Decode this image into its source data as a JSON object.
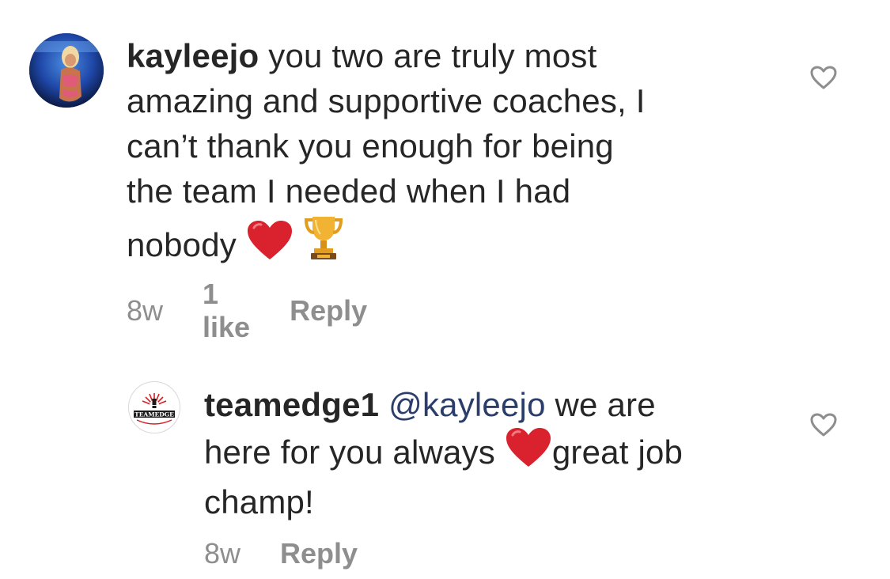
{
  "comments": [
    {
      "username": "kayleejo",
      "text_lines": [
        "you two are truly most",
        "amazing and supportive coaches, I",
        "can’t thank you enough for being",
        "the team I needed when I had",
        "nobody"
      ],
      "emojis": [
        "red-heart-emoji",
        "trophy-emoji"
      ],
      "time": "8w",
      "likes": "1 like",
      "reply_label": "Reply"
    },
    {
      "username": "teamedge1",
      "mention": "@kayleejo",
      "text_part1": "we are",
      "text_part2": "here for you always",
      "text_part3": "great job",
      "text_part4": "champ!",
      "emojis": [
        "red-heart-emoji"
      ],
      "avatar_logo_text": "TEAMEDGE",
      "time": "8w",
      "reply_label": "Reply"
    }
  ],
  "colors": {
    "text": "#262626",
    "secondary": "#8e8e8e",
    "mention": "#2b3d6b",
    "heart": "#e0242f",
    "trophy": "#e8a62a"
  }
}
